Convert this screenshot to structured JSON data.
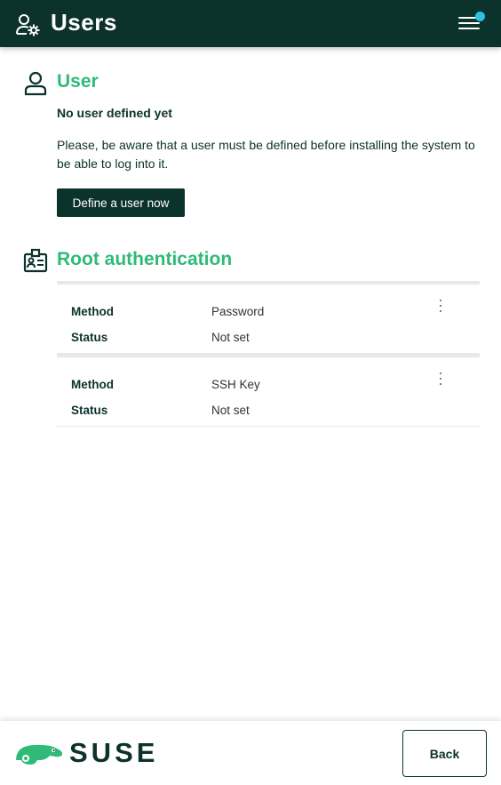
{
  "header": {
    "title": "Users",
    "icon": "users-settings-icon",
    "menu_icon": "hamburger-menu-icon",
    "notification_color": "#30bfe8"
  },
  "user_section": {
    "title": "User",
    "icon": "person-icon",
    "status": "No user defined yet",
    "notice": "Please, be aware that a user must be defined before installing the system to be able to log into it.",
    "define_button": "Define a user now"
  },
  "root_section": {
    "title": "Root authentication",
    "icon": "id-card-icon",
    "methods": [
      {
        "method_label": "Method",
        "method_value": "Password",
        "status_label": "Status",
        "status_value": "Not set"
      },
      {
        "method_label": "Method",
        "method_value": "SSH Key",
        "status_label": "Status",
        "status_value": "Not set"
      }
    ]
  },
  "footer": {
    "logo_text": "SUSE",
    "back_button": "Back"
  },
  "colors": {
    "brand_dark": "#0c322c",
    "brand_green": "#30ba78"
  }
}
